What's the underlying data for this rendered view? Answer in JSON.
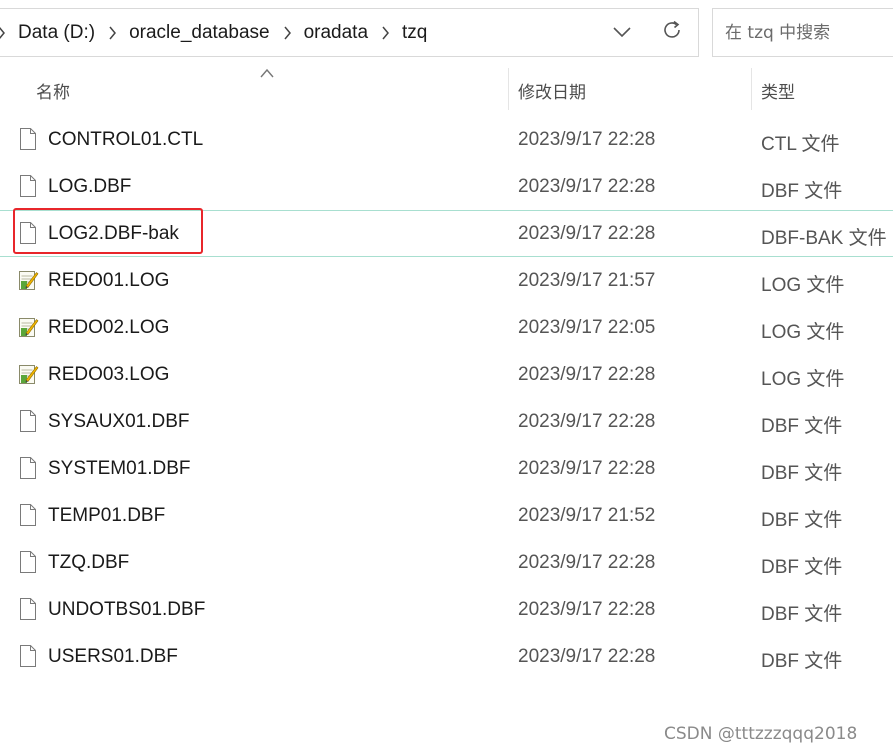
{
  "breadcrumb": [
    "Data (D:)",
    "oracle_database",
    "oradata",
    "tzq"
  ],
  "search": {
    "placeholder": "在 tzq 中搜索"
  },
  "columns": {
    "name": "名称",
    "date": "修改日期",
    "type": "类型"
  },
  "files": [
    {
      "name": "CONTROL01.CTL",
      "date": "2023/9/17 22:28",
      "type": "CTL 文件",
      "icon": "blank-file-icon"
    },
    {
      "name": "LOG.DBF",
      "date": "2023/9/17 22:28",
      "type": "DBF 文件",
      "icon": "blank-file-icon"
    },
    {
      "name": "LOG2.DBF-bak",
      "date": "2023/9/17 22:28",
      "type": "DBF-BAK 文件",
      "icon": "blank-file-icon",
      "highlighted": true
    },
    {
      "name": "REDO01.LOG",
      "date": "2023/9/17 21:57",
      "type": "LOG 文件",
      "icon": "log-file-icon"
    },
    {
      "name": "REDO02.LOG",
      "date": "2023/9/17 22:05",
      "type": "LOG 文件",
      "icon": "log-file-icon"
    },
    {
      "name": "REDO03.LOG",
      "date": "2023/9/17 22:28",
      "type": "LOG 文件",
      "icon": "log-file-icon"
    },
    {
      "name": "SYSAUX01.DBF",
      "date": "2023/9/17 22:28",
      "type": "DBF 文件",
      "icon": "blank-file-icon"
    },
    {
      "name": "SYSTEM01.DBF",
      "date": "2023/9/17 22:28",
      "type": "DBF 文件",
      "icon": "blank-file-icon"
    },
    {
      "name": "TEMP01.DBF",
      "date": "2023/9/17 21:52",
      "type": "DBF 文件",
      "icon": "blank-file-icon"
    },
    {
      "name": "TZQ.DBF",
      "date": "2023/9/17 22:28",
      "type": "DBF 文件",
      "icon": "blank-file-icon"
    },
    {
      "name": "UNDOTBS01.DBF",
      "date": "2023/9/17 22:28",
      "type": "DBF 文件",
      "icon": "blank-file-icon"
    },
    {
      "name": "USERS01.DBF",
      "date": "2023/9/17 22:28",
      "type": "DBF 文件",
      "icon": "blank-file-icon"
    }
  ],
  "watermark": "CSDN @tttzzzqqq2018",
  "colors": {
    "highlight_border": "#a8dfd0",
    "annotation_box": "#e8262b"
  }
}
